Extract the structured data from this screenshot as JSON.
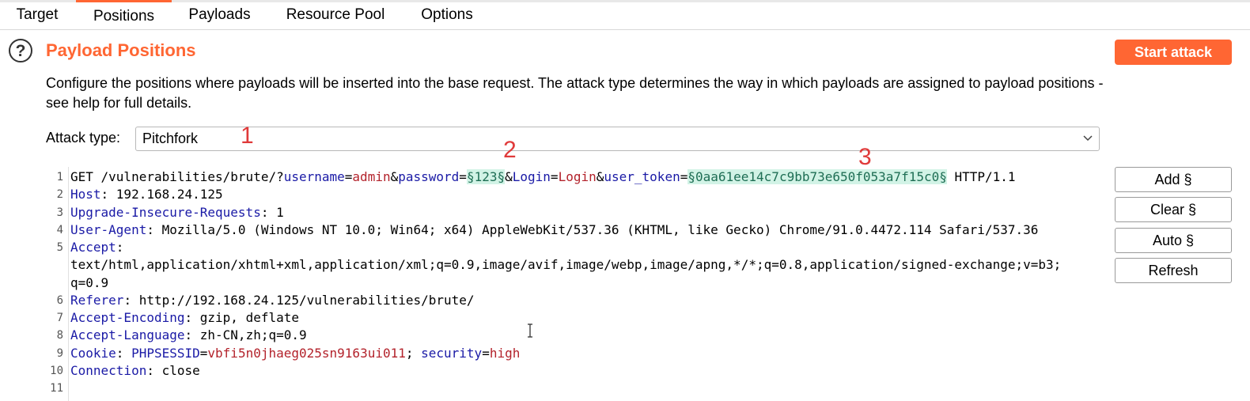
{
  "tabs": [
    {
      "label": "Target"
    },
    {
      "label": "Positions",
      "active": true
    },
    {
      "label": "Payloads"
    },
    {
      "label": "Resource Pool"
    },
    {
      "label": "Options"
    }
  ],
  "header": {
    "help_icon": "?",
    "title": "Payload Positions",
    "start_attack_label": "Start attack",
    "description": "Configure the positions where payloads will be inserted into the base request. The attack type determines the way in which payloads are assigned to payload positions - see help for full details."
  },
  "attack_type": {
    "label": "Attack type:",
    "value": "Pitchfork"
  },
  "request": {
    "line1": {
      "method_path": "GET /vulnerabilities/brute/?",
      "p1_name": "username",
      "eq1": "=",
      "p1_value": "admin",
      "amp1": "&",
      "p2_name": "password",
      "eq2": "=",
      "p2_payload": "§123§",
      "amp2": "&",
      "p3_name": "Login",
      "eq3": "=",
      "p3_value": "Login",
      "amp3": "&",
      "p4_name": "user_token",
      "eq4": "=",
      "p4_payload": "§0aa61ee14c7c9bb73e650f053a7f15c0§",
      "protocol": " HTTP/1.1"
    },
    "host_key": "Host",
    "host_value": ": 192.168.24.125",
    "uir_key": "Upgrade-Insecure-Requests",
    "uir_value": ": 1",
    "ua_key": "User-Agent",
    "ua_value": ": Mozilla/5.0 (Windows NT 10.0; Win64; x64) AppleWebKit/537.36 (KHTML, like Gecko) Chrome/91.0.4472.114 Safari/537.36",
    "accept_key": "Accept",
    "accept_colon": ":",
    "accept_value_1": "text/html,application/xhtml+xml,application/xml;q=0.9,image/avif,image/webp,image/apng,*/*;q=0.8,application/signed-exchange;v=b3;",
    "accept_value_2": "q=0.9",
    "referer_key": "Referer",
    "referer_value": ": http://192.168.24.125/vulnerabilities/brute/",
    "ae_key": "Accept-Encoding",
    "ae_value": ": gzip, deflate",
    "al_key": "Accept-Language",
    "al_value": ": zh-CN,zh;q=0.9",
    "cookie_key": "Cookie",
    "cookie_colon": ": ",
    "c1_name": "PHPSESSID",
    "c1_eq": "=",
    "c1_value": "vbfi5n0jhaeg025sn9163ui011",
    "c_sep": "; ",
    "c2_name": "security",
    "c2_eq": "=",
    "c2_value": "high",
    "conn_key": "Connection",
    "conn_value": ": close"
  },
  "line_numbers": [
    "1",
    "2",
    "3",
    "4",
    "5",
    "6",
    "7",
    "8",
    "9",
    "10",
    "11"
  ],
  "side_buttons": {
    "add": "Add §",
    "clear": "Clear §",
    "auto": "Auto §",
    "refresh": "Refresh"
  },
  "annotations": {
    "a1": "1",
    "a2": "2",
    "a3": "3"
  },
  "colors": {
    "accent": "#ff6633",
    "payload_bg": "#d2f3e6",
    "annotation": "#e03a3a"
  }
}
